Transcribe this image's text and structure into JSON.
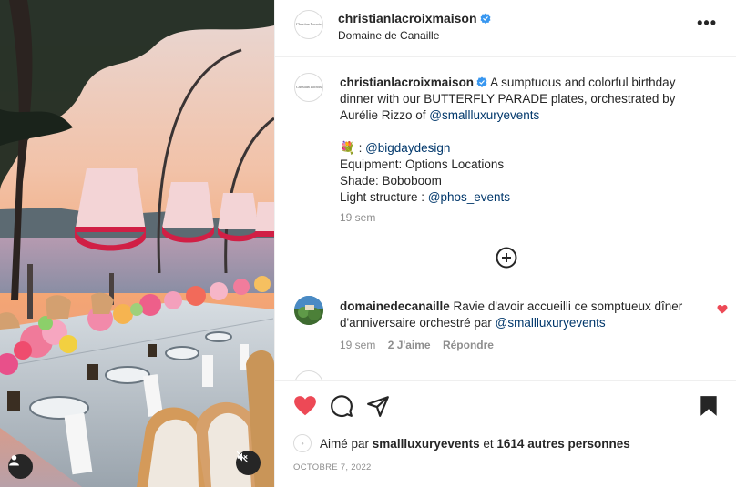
{
  "post": {
    "username": "christianlacroixmaison",
    "verified": true,
    "location": "Domaine de Canaille",
    "avatar_text": "Christian Lacroix",
    "more_icon": "more-horizontal-icon"
  },
  "caption": {
    "username": "christianlacroixmaison",
    "text_1": " A sumptuous and colorful birthday dinner with our BUTTERFLY PARADE plates, orchestrated by Aurélie Rizzo of ",
    "mention_1": "@smallluxuryevents",
    "flower_emoji": "💐",
    "flower_sep": " : ",
    "mention_2": "@bigdaydesign",
    "line_equipment": "Equipment: Options Locations",
    "line_shade": "Shade: Boboboom",
    "light_prefix": "Light structure : ",
    "mention_3": "@phos_events",
    "time": "19 sem"
  },
  "load_more_icon": "plus-circle-icon",
  "comments": [
    {
      "username": "domainedecanaille",
      "text": " Ravie d'avoir accueilli ce somptueux dîner d'anniversaire orchestré par ",
      "mention": "@smallluxuryevents",
      "time": "19 sem",
      "likes": "2 J'aime",
      "reply": "Répondre",
      "liked": true
    }
  ],
  "actions": {
    "like_icon": "heart-filled-icon",
    "comment_icon": "comment-icon",
    "share_icon": "send-icon",
    "save_icon": "bookmark-filled-icon"
  },
  "likes": {
    "prefix": "Aimé par ",
    "user": "smallluxuryevents",
    "middle": " et ",
    "count": "1614 autres personnes"
  },
  "date": "OCTOBRE 7, 2022",
  "media": {
    "user_tag_icon": "user-icon",
    "mute_icon": "speaker-muted-icon"
  },
  "colors": {
    "like_red": "#ed4956",
    "verified_blue": "#3897f0",
    "link_blue": "#00376b",
    "muted_gray": "#8e8e8e"
  }
}
